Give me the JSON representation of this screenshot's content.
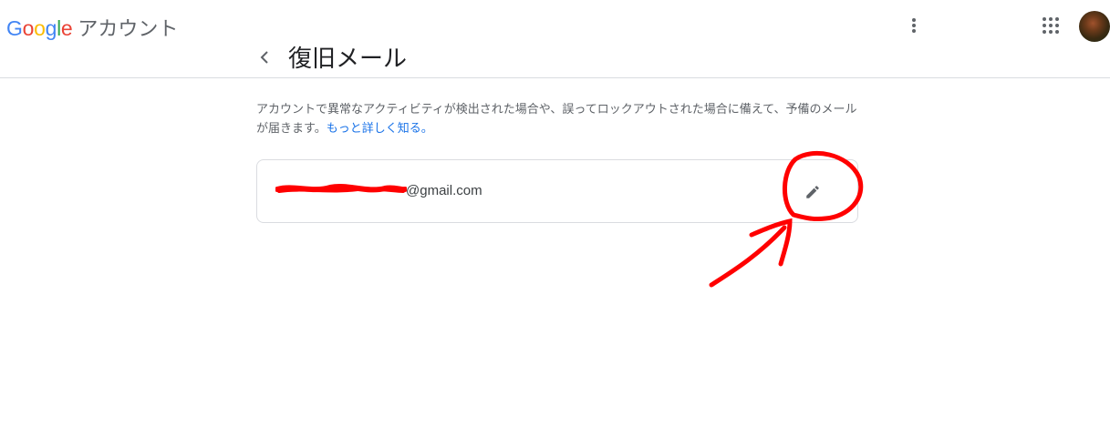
{
  "header": {
    "logo": "Google",
    "product": "アカウント"
  },
  "page": {
    "title": "復旧メール",
    "description": "アカウントで異常なアクティビティが検出された場合や、誤ってロックアウトされた場合に備えて、予備のメールが届きます。",
    "learn_more": "もっと詳しく知る。"
  },
  "email_card": {
    "email_suffix": "@gmail.com",
    "edit_icon": "pencil-icon"
  },
  "icons": {
    "back": "arrow-back-icon",
    "more": "more-vert-icon",
    "apps": "apps-grid-icon"
  },
  "colors": {
    "annotation": "#ff0000",
    "link": "#1a73e8",
    "google_blue": "#4285f4",
    "google_red": "#ea4335",
    "google_yellow": "#fbbc05",
    "google_green": "#34a853"
  }
}
